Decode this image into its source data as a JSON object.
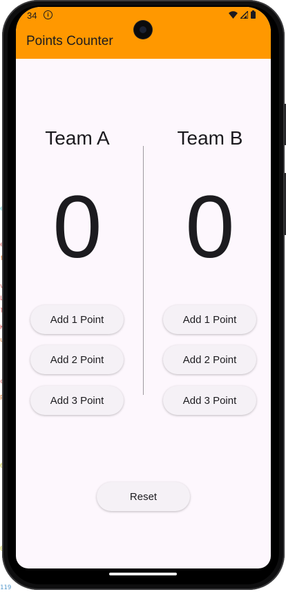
{
  "status_bar": {
    "time": "34",
    "info_icon": "i"
  },
  "app_bar": {
    "title": "Points Counter",
    "background_color": "#ff9800"
  },
  "team_a": {
    "name": "Team A",
    "score": "0",
    "buttons": [
      "Add 1 Point",
      "Add 2 Point",
      "Add 3 Point"
    ]
  },
  "team_b": {
    "name": "Team B",
    "score": "0",
    "buttons": [
      "Add 1 Point",
      "Add 2 Point",
      "Add 3 Point"
    ]
  },
  "reset_label": "Reset",
  "colors": {
    "screen_background": "#fdf7fd",
    "button_background": "#f5f1f6",
    "text": "#1c1b1f"
  },
  "ide_sidebar_marks": [
    "e",
    "f",
    "v",
    "L",
    "l",
    "K",
    "u",
    "c",
    "p",
    "6",
    "0"
  ],
  "ide_bottom_number": "119"
}
